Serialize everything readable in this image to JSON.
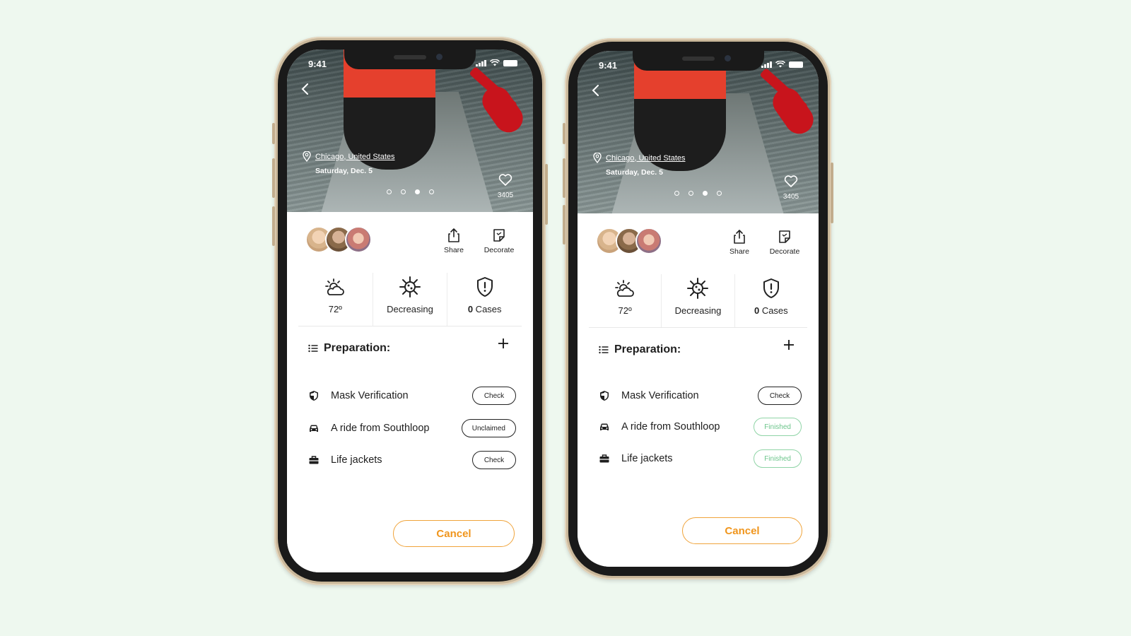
{
  "colors": {
    "accent": "#f0951c",
    "finished": "#6cc58b",
    "background": "#eef8ef"
  },
  "phones": [
    {
      "status_time": "9:41",
      "location": "Chicago, United States",
      "date": "Saturday, Dec. 5",
      "likes": "3405",
      "active_dot": 2,
      "actions": {
        "share": "Share",
        "decorate": "Decorate"
      },
      "stats": {
        "temperature": "72º",
        "trend": "Decreasing",
        "cases_count": "0",
        "cases_label": " Cases"
      },
      "preparation_title": "Preparation:",
      "items": [
        {
          "name": "Mask Verification",
          "icon": "shield-icon",
          "status": "Check",
          "finished": false
        },
        {
          "name": "A ride from Southloop",
          "icon": "car-icon",
          "status": "Unclaimed",
          "finished": false
        },
        {
          "name": "Life jackets",
          "icon": "toolbox-icon",
          "status": "Check",
          "finished": false
        }
      ],
      "cancel_label": "Cancel"
    },
    {
      "status_time": "9:41",
      "location": "Chicago, United States",
      "date": "Saturday, Dec. 5",
      "likes": "3405",
      "active_dot": 2,
      "actions": {
        "share": "Share",
        "decorate": "Decorate"
      },
      "stats": {
        "temperature": "72º",
        "trend": "Decreasing",
        "cases_count": "0",
        "cases_label": " Cases"
      },
      "preparation_title": "Preparation:",
      "items": [
        {
          "name": "Mask Verification",
          "icon": "shield-icon",
          "status": "Check",
          "finished": false
        },
        {
          "name": "A ride from Southloop",
          "icon": "car-icon",
          "status": "Finished",
          "finished": true
        },
        {
          "name": "Life jackets",
          "icon": "toolbox-icon",
          "status": "Finished",
          "finished": true
        }
      ],
      "cancel_label": "Cancel"
    }
  ]
}
